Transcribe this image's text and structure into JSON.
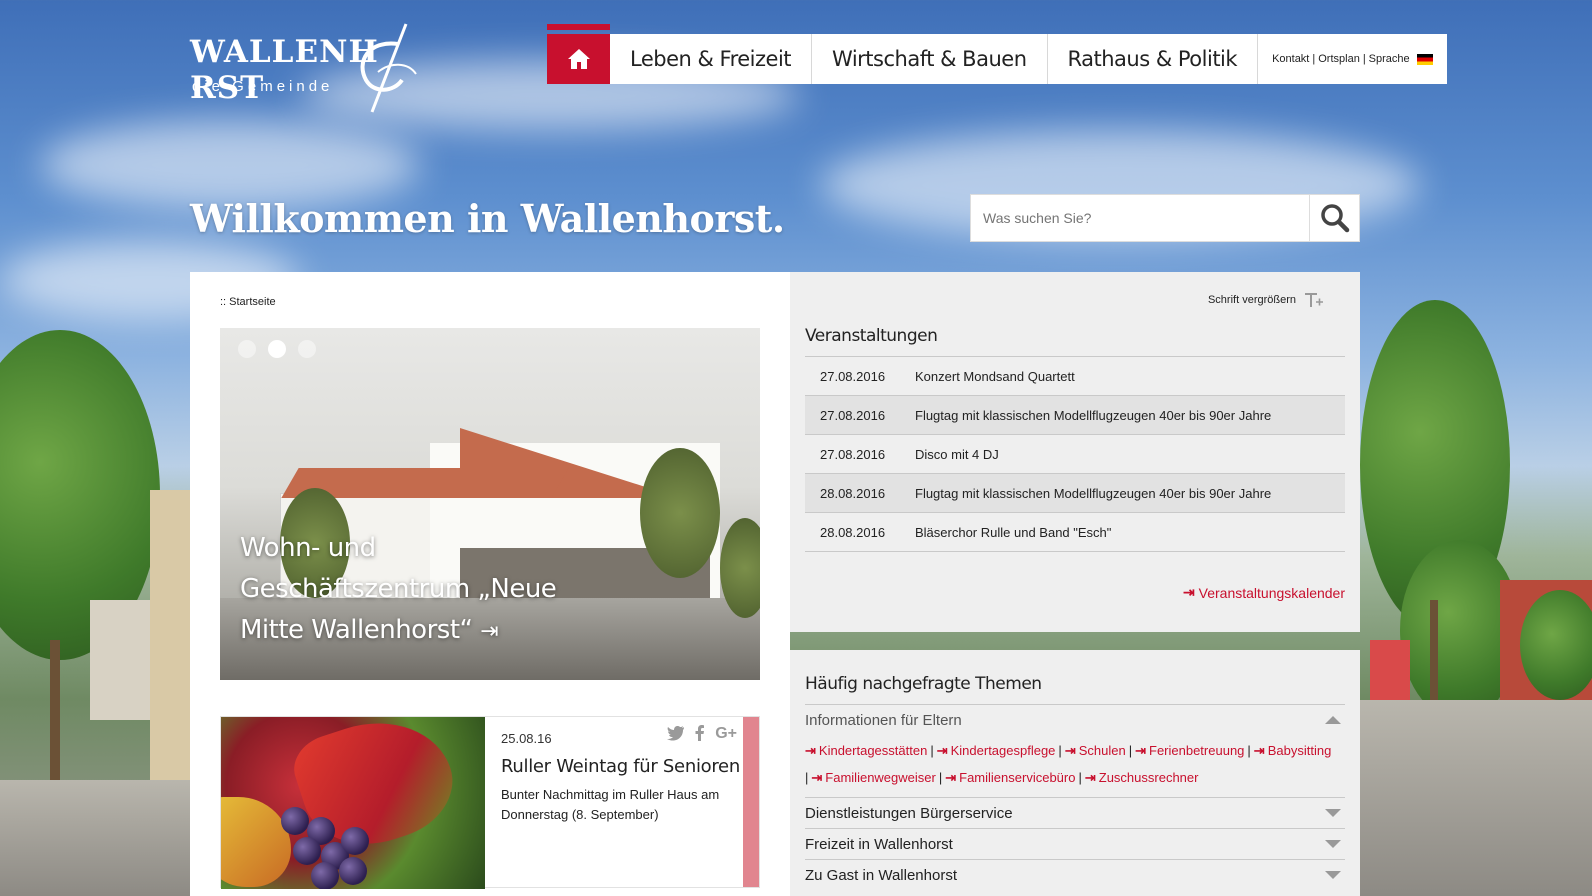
{
  "logo": {
    "title": "WALLENH RST",
    "subtitle": "die Gemeinde"
  },
  "nav": {
    "items": [
      {
        "label": "Leben & Freizeit"
      },
      {
        "label": "Wirtschaft & Bauen"
      },
      {
        "label": "Rathaus & Politik"
      }
    ],
    "util": {
      "kontakt": "Kontakt",
      "ortsplan": "Ortsplan",
      "sprache": "Sprache",
      "sep": "|"
    }
  },
  "hero": {
    "welcome": "Willkommen in Wallenhorst.",
    "search_placeholder": "Was suchen Sie?"
  },
  "breadcrumb": ":: Startseite",
  "slider": {
    "caption": "Wohn- und Geschäftszentrum „Neue Mitte Wallenhorst“",
    "dots": 3,
    "active_dot": 2
  },
  "news": {
    "date": "25.08.16",
    "title": "Ruller Weintag für Senioren",
    "text": "Bunter Nachmittag im Ruller Haus am Donnerstag (8. September)"
  },
  "font_size_label": "Schrift vergrößern",
  "events": {
    "title": "Veranstaltungen",
    "rows": [
      {
        "date": "27.08.2016",
        "name": "Konzert Mondsand Quartett"
      },
      {
        "date": "27.08.2016",
        "name": "Flugtag mit klassischen Modellflugzeugen 40er bis 90er Jahre"
      },
      {
        "date": "27.08.2016",
        "name": "Disco mit 4 DJ"
      },
      {
        "date": "28.08.2016",
        "name": "Flugtag mit klassischen Modellflugzeugen 40er bis 90er Jahre"
      },
      {
        "date": "28.08.2016",
        "name": "Bläserchor Rulle und Band \"Esch\""
      }
    ],
    "calendar_link": "Veranstaltungskalender"
  },
  "topics": {
    "title": "Häufig nachgefragte Themen",
    "sections": [
      {
        "label": "Informationen für Eltern",
        "links": [
          "Kindertagesstätten",
          "Kindertagespflege",
          "Schulen",
          "Ferienbetreuung",
          "Babysitting",
          "Familienwegweiser",
          "Familienservicebüro",
          "Zuschussrechner"
        ]
      },
      {
        "label": "Dienstleistungen Bürgerservice"
      },
      {
        "label": "Freizeit in Wallenhorst"
      },
      {
        "label": "Zu Gast in Wallenhorst"
      }
    ]
  },
  "colors": {
    "accent": "#c8102e",
    "panel": "#efefef"
  }
}
